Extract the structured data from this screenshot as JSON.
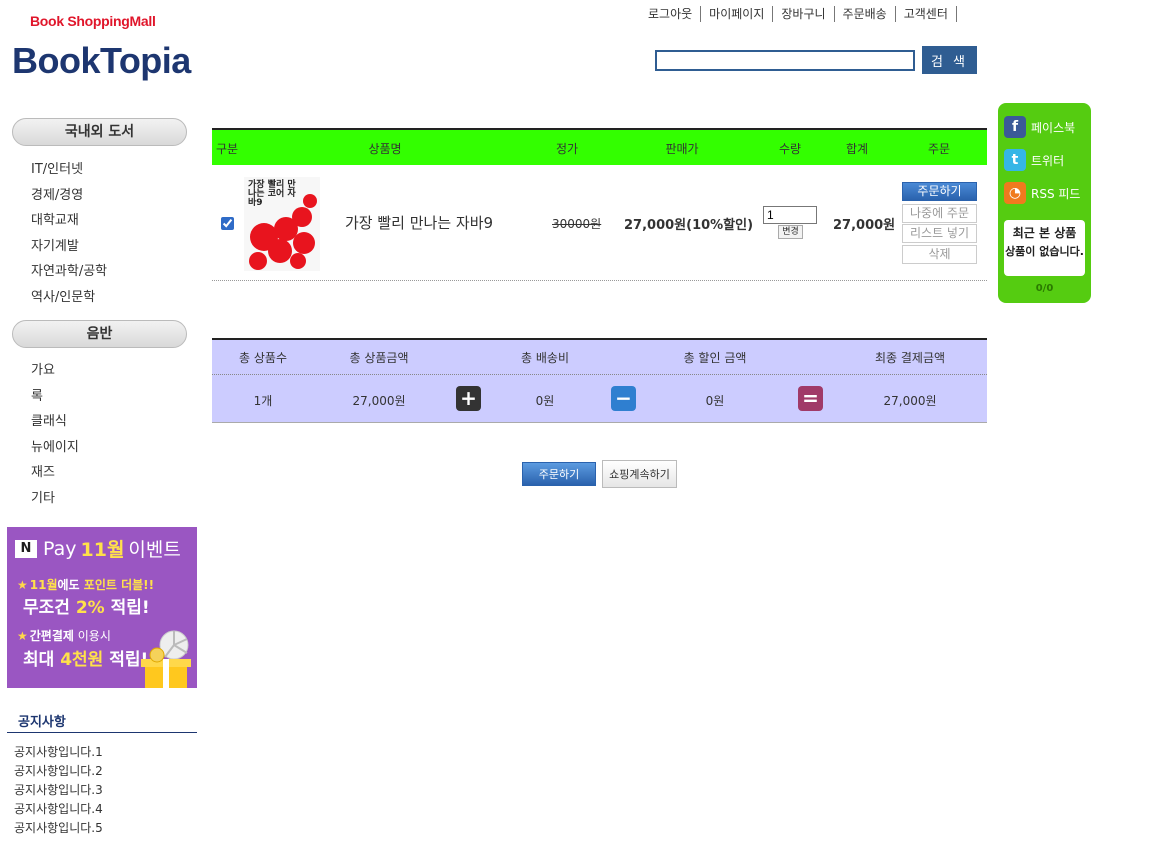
{
  "header": {
    "logo_small": "Book ShoppingMall",
    "logo_big": "BookTopia",
    "nav": [
      "로그아웃",
      "마이페이지",
      "장바구니",
      "주문배송",
      "고객센터"
    ],
    "search_value": "",
    "search_button": "검 색"
  },
  "sidebar": {
    "domestic_header": "국내외 도서",
    "domestic_items": [
      "IT/인터넷",
      "경제/경영",
      "대학교재",
      "자기계발",
      "자연과학/공학",
      "역사/인문학"
    ],
    "music_header": "음반",
    "music_items": [
      "가요",
      "록",
      "클래식",
      "뉴에이지",
      "재즈",
      "기타"
    ],
    "banner": {
      "brand": "Pay",
      "month": "11월",
      "event": "이벤트",
      "line1a": "11월",
      "line1b": "에도 ",
      "line1c": "포인트 더블!!",
      "line2a": "무조건 ",
      "line2b": "2%",
      "line2c": " 적립!",
      "line3a": "간편결제",
      "line3b": " 이용시",
      "line4a": "최대 ",
      "line4b": "4천원",
      "line4c": " 적립!"
    },
    "notice_title": "공지사항",
    "notices": [
      "공지사항입니다.1",
      "공지사항입니다.2",
      "공지사항입니다.3",
      "공지사항입니다.4",
      "공지사항입니다.5"
    ]
  },
  "cart": {
    "columns": [
      "구분",
      "상품명",
      "정가",
      "판매가",
      "수량",
      "합계",
      "주문"
    ],
    "item": {
      "checked": true,
      "cover_text": "가장 빨리 만나는 코어 자바9",
      "name": "가장 빨리 만나는 자바9",
      "list_price": "30000원",
      "sale_price": "27,000원(10%할인)",
      "quantity": "1",
      "change_button": "변경",
      "total": "27,000원",
      "actions": [
        "주문하기",
        "나중에 주문",
        "리스트 넣기",
        "삭제"
      ]
    }
  },
  "summary": {
    "labels": [
      "총 상품수",
      "총 상품금액",
      "총 배송비",
      "총 할인 금액",
      "최종 결제금액"
    ],
    "values": [
      "1개",
      "27,000원",
      "0원",
      "0원",
      "27,000원"
    ]
  },
  "buttons": {
    "order": "주문하기",
    "continue": "쇼핑계속하기"
  },
  "side_panel": {
    "social": [
      {
        "label": "페이스북",
        "icon": "facebook-icon"
      },
      {
        "label": "트위터",
        "icon": "twitter-icon"
      },
      {
        "label": "RSS 피드",
        "icon": "rss-icon"
      }
    ],
    "recent_title": "최근 본 상품",
    "recent_message": "상품이 없습니다.",
    "page_count": "0/0"
  },
  "colors": {
    "brand_navy": "#1d3670",
    "logo_red": "#e0162b",
    "cart_header_bg": "#33ff00",
    "summary_bg": "#ccccff",
    "side_panel_bg": "#55cc11",
    "accent_blue": "#2f5d92"
  }
}
